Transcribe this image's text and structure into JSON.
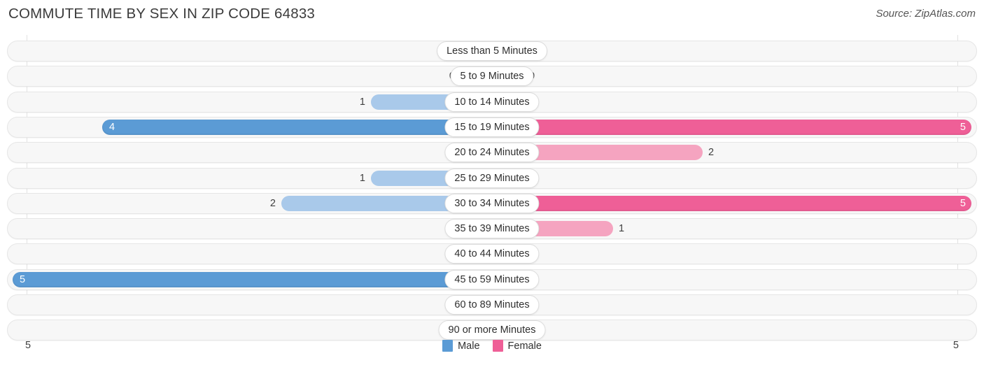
{
  "header": {
    "title": "COMMUTE TIME BY SEX IN ZIP CODE 64833",
    "source": "Source: ZipAtlas.com"
  },
  "legend": {
    "male_label": "Male",
    "female_label": "Female",
    "male_color": "#5b9bd5",
    "female_color": "#ef5f97"
  },
  "axis": {
    "left_end": "5",
    "right_end": "5"
  },
  "chart_data": {
    "type": "bar",
    "title": "COMMUTE TIME BY SEX IN ZIP CODE 64833",
    "xlabel": "",
    "ylabel": "",
    "orientation": "horizontal-diverging",
    "xlim": [
      5,
      5
    ],
    "grid": true,
    "legend_position": "bottom-center",
    "categories": [
      "Less than 5 Minutes",
      "5 to 9 Minutes",
      "10 to 14 Minutes",
      "15 to 19 Minutes",
      "20 to 24 Minutes",
      "25 to 29 Minutes",
      "30 to 34 Minutes",
      "35 to 39 Minutes",
      "40 to 44 Minutes",
      "45 to 59 Minutes",
      "60 to 89 Minutes",
      "90 or more Minutes"
    ],
    "series": [
      {
        "name": "Male",
        "color": "#5b9bd5",
        "values": [
          0,
          0,
          1,
          4,
          0,
          1,
          2,
          0,
          0,
          5,
          0,
          0
        ],
        "labels": [
          "0",
          "0",
          "1",
          "4",
          "0",
          "1",
          "2",
          "0",
          "0",
          "5",
          "0",
          "0"
        ]
      },
      {
        "name": "Female",
        "color": "#ef5f97",
        "values": [
          0,
          0,
          0,
          5,
          2,
          0,
          5,
          1,
          0,
          0,
          0,
          0
        ],
        "labels": [
          "0",
          "0",
          "0",
          "5",
          "2",
          "0",
          "5",
          "1",
          "0",
          "0",
          "0",
          "0"
        ]
      }
    ]
  }
}
